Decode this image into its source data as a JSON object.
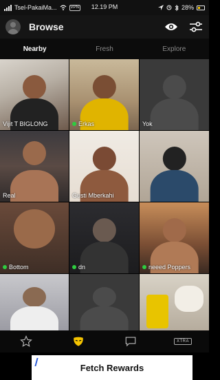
{
  "status_bar": {
    "carrier": "Tsel-PakaiMa...",
    "vpn": "VPN",
    "time": "12.19 PM",
    "battery": "28%"
  },
  "header": {
    "title": "Browse",
    "icons": [
      "avatar",
      "eye-icon",
      "filter-sliders-icon"
    ]
  },
  "tabs": [
    {
      "label": "Nearby",
      "active": true
    },
    {
      "label": "Fresh",
      "active": false
    },
    {
      "label": "Explore",
      "active": false
    }
  ],
  "profiles": [
    {
      "name": "Vijit T BIGLONG",
      "online": false
    },
    {
      "name": "Erkas",
      "online": true
    },
    {
      "name": "Yok",
      "online": false
    },
    {
      "name": "Real",
      "online": false
    },
    {
      "name": "Gusti Mberkahi",
      "online": false
    },
    {
      "name": "",
      "online": false
    },
    {
      "name": "Bottom",
      "online": true
    },
    {
      "name": "dn",
      "online": true
    },
    {
      "name": "neeed Poppers",
      "online": true
    },
    {
      "name": "",
      "online": false
    },
    {
      "name": "",
      "online": false
    },
    {
      "name": "",
      "online": false
    }
  ],
  "bottom_nav": {
    "items": [
      "star-icon",
      "grindr-mask-icon",
      "chat-icon",
      "xtra-badge"
    ],
    "xtra_label": "XTRA"
  },
  "ad": {
    "title": "Fetch Rewards"
  },
  "colors": {
    "accent": "#F5C400",
    "online": "#2ECC40",
    "background": "#000000"
  }
}
